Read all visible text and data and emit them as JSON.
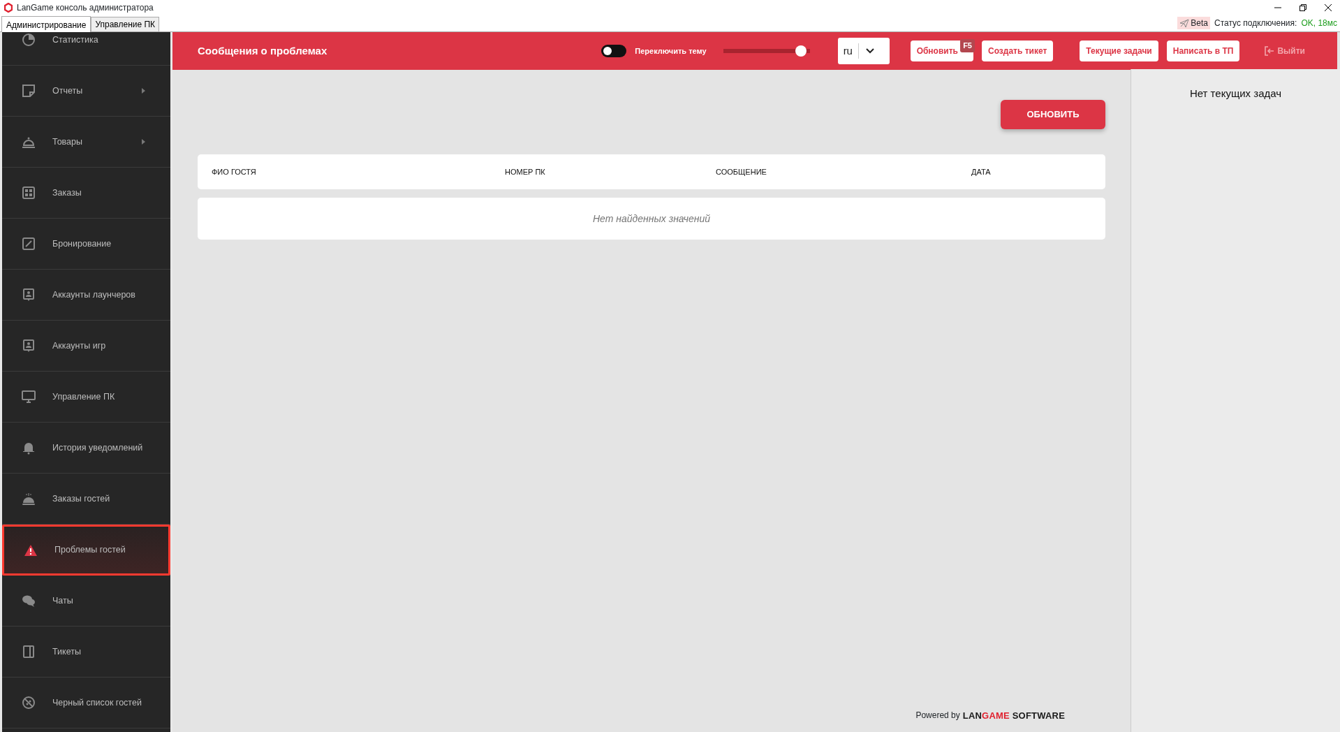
{
  "window": {
    "title": "LanGame консоль администратора"
  },
  "tabs": [
    {
      "label": "Администрирование",
      "selected": true
    },
    {
      "label": "Управление ПК",
      "selected": false
    }
  ],
  "status": {
    "beta": "Beta",
    "label": "Статус подключения:",
    "value": "OK, 18мс"
  },
  "sidebar": {
    "items": [
      {
        "label": "Статистика",
        "submenu": false,
        "selected": false
      },
      {
        "label": "Отчеты",
        "submenu": true,
        "selected": false
      },
      {
        "label": "Товары",
        "submenu": true,
        "selected": false
      },
      {
        "label": "Заказы",
        "submenu": false,
        "selected": false
      },
      {
        "label": "Бронирование",
        "submenu": false,
        "selected": false
      },
      {
        "label": "Аккаунты лаунчеров",
        "submenu": false,
        "selected": false
      },
      {
        "label": "Аккаунты игр",
        "submenu": false,
        "selected": false
      },
      {
        "label": "Управление ПК",
        "submenu": false,
        "selected": false
      },
      {
        "label": "История уведомлений",
        "submenu": false,
        "selected": false
      },
      {
        "label": "Заказы гостей",
        "submenu": false,
        "selected": false
      },
      {
        "label": "Проблемы гостей",
        "submenu": false,
        "selected": true
      },
      {
        "label": "Чаты",
        "submenu": false,
        "selected": false
      },
      {
        "label": "Тикеты",
        "submenu": false,
        "selected": false
      },
      {
        "label": "Черный список гостей",
        "submenu": false,
        "selected": false
      }
    ]
  },
  "header": {
    "title": "Сообщения о проблемах",
    "theme_toggle": {
      "label": "Переключить тему",
      "on": false
    },
    "slider": {
      "level": 0.9
    },
    "language": "ru",
    "buttons": [
      {
        "label": "Обновить",
        "badge": "F5"
      },
      {
        "label": "Создать тикет"
      },
      {
        "label": "Текущие задачи"
      },
      {
        "label": "Написать в ТП"
      }
    ],
    "logout": "Выйти"
  },
  "refresh_button": "ОБНОВИТЬ",
  "table": {
    "columns": [
      "ФИО ГОСТЯ",
      "НОМЕР ПК",
      "СООБЩЕНИЕ",
      "ДАТА"
    ],
    "empty": "Нет найденных значений"
  },
  "footer": {
    "powered": "Powered by",
    "brand": [
      {
        "text": "LAN",
        "color": "#1a1a1a"
      },
      {
        "text": "GAME",
        "color": "#e0202e"
      },
      {
        "text": " SOFTWARE",
        "color": "#1a1a1a"
      }
    ]
  },
  "tasks_panel": {
    "empty": "Нет текущих задач"
  }
}
